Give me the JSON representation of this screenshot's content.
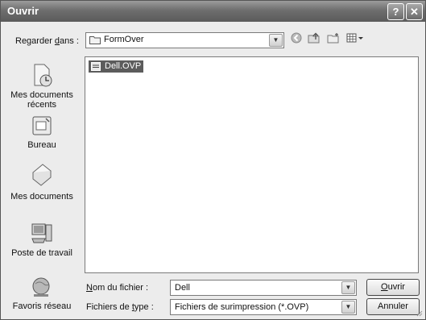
{
  "window": {
    "title": "Ouvrir",
    "help_glyph": "?",
    "close_glyph": "✕"
  },
  "lookin": {
    "label": "Regarder dans :",
    "value": "FormOver"
  },
  "toolbar": {
    "icons": [
      "back-icon",
      "up-folder-icon",
      "new-folder-icon",
      "views-menu-icon"
    ]
  },
  "places": [
    {
      "label": "Mes documents récents",
      "icon": "recent-documents-icon"
    },
    {
      "label": "Bureau",
      "icon": "desktop-icon"
    },
    {
      "label": "Mes documents",
      "icon": "my-documents-icon"
    },
    {
      "label": "Poste de travail",
      "icon": "my-computer-icon"
    },
    {
      "label": "Favoris réseau",
      "icon": "network-places-icon"
    }
  ],
  "files": [
    {
      "name": "Dell.OVP",
      "selected": true
    }
  ],
  "filename": {
    "label": "Nom du fichier :",
    "value": "Dell"
  },
  "filetype": {
    "label": "Fichiers de type :",
    "value": "Fichiers de surimpression (*.OVP)"
  },
  "buttons": {
    "open": "Ouvrir",
    "cancel": "Annuler"
  }
}
